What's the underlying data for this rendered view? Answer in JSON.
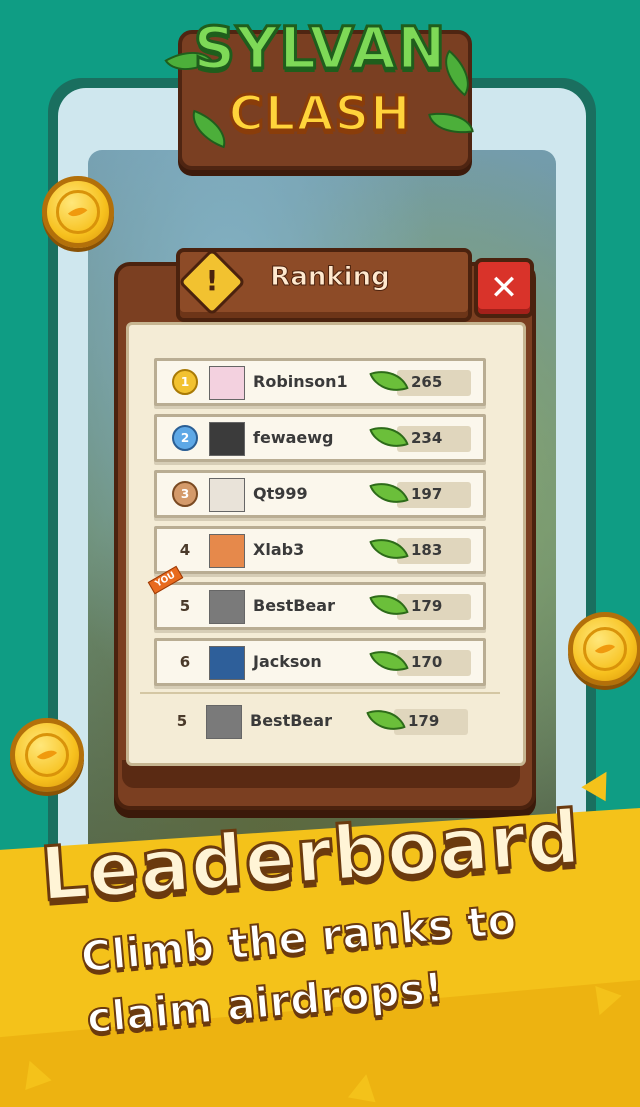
{
  "logo": {
    "line1": "SYLVAN",
    "line2": "CLASH"
  },
  "panel": {
    "title": "Ranking",
    "close_label": "✕",
    "warn_label": "!"
  },
  "you_tag": "YOU",
  "rows": [
    {
      "rank": "1",
      "rank_style": "gold-medal",
      "name": "Robinson1",
      "score": "265",
      "avatar": "#f3d1df"
    },
    {
      "rank": "2",
      "rank_style": "silver-medal",
      "name": "fewaewg",
      "score": "234",
      "avatar": "#3b3b3b"
    },
    {
      "rank": "3",
      "rank_style": "bronze-medal",
      "name": "Qt999",
      "score": "197",
      "avatar": "#e9e3d9"
    },
    {
      "rank": "4",
      "rank_style": "number",
      "name": "Xlab3",
      "score": "183",
      "avatar": "#e6894b"
    },
    {
      "rank": "5",
      "rank_style": "number",
      "name": "BestBear",
      "score": "179",
      "avatar": "#7a7a7a",
      "is_you": true
    },
    {
      "rank": "6",
      "rank_style": "number",
      "name": "Jackson",
      "score": "170",
      "avatar": "#2e5f9a"
    }
  ],
  "my_row": {
    "rank": "5",
    "name": "BestBear",
    "score": "179",
    "avatar": "#7a7a7a"
  },
  "headline": "Leaderboard",
  "subline1": "Climb the ranks to",
  "subline2": "claim airdrops!",
  "colors": {
    "bg": "#0f9d84",
    "banner": "#f4c21a",
    "panel": "#7b3f21",
    "paper": "#f4ecd6"
  }
}
